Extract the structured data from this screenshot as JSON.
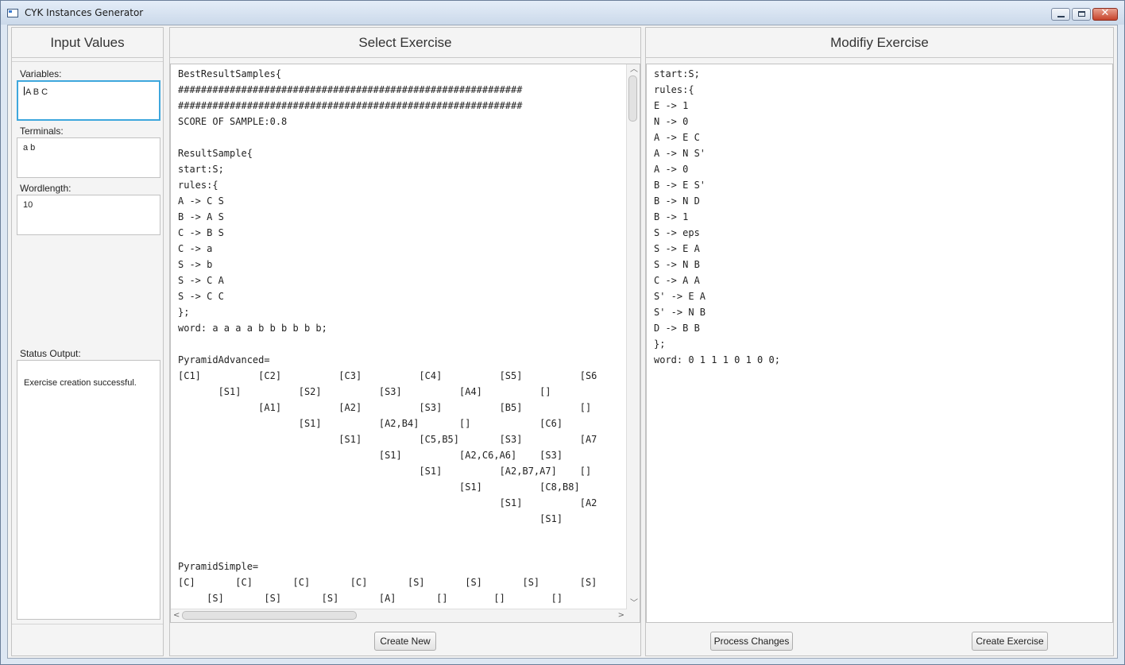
{
  "window": {
    "title": "CYK Instances Generator"
  },
  "input_panel": {
    "title": "Input Values",
    "variables_label": "Variables:",
    "variables_value": "A B C",
    "terminals_label": "Terminals:",
    "terminals_value": "a b",
    "wordlength_label": "Wordlength:",
    "wordlength_value": "10",
    "status_label": "Status Output:",
    "status_value": "Exercise creation successful."
  },
  "select_panel": {
    "title": "Select Exercise",
    "content": "BestResultSamples{\n############################################################\n############################################################\nSCORE OF SAMPLE:0.8\n\nResultSample{\nstart:S;\nrules:{\nA -> C S\nB -> A S\nC -> B S\nC -> a\nS -> b\nS -> C A\nS -> C C\n};\nword: a a a a b b b b b b;\n\nPyramidAdvanced=\n[C1]          [C2]          [C3]          [C4]          [S5]          [S6\n       [S1]          [S2]          [S3]          [A4]          []\n              [A1]          [A2]          [S3]          [B5]          []\n                     [S1]          [A2,B4]       []            [C6]\n                            [S1]          [C5,B5]       [S3]          [A7\n                                   [S1]          [A2,C6,A6]    [S3]\n                                          [S1]          [A2,B7,A7]    []\n                                                 [S1]          [C8,B8]\n                                                        [S1]          [A2\n                                                               [S1]\n\n\nPyramidSimple=\n[C]       [C]       [C]       [C]       [S]       [S]       [S]       [S]\n     [S]       [S]       [S]       [A]       []        []        []\n          [A]       [A]       [S]       [B]       []        []        []",
    "create_new_label": "Create New"
  },
  "modify_panel": {
    "title": "Modifiy Exercise",
    "content": "start:S;\nrules:{\nE -> 1\nN -> 0\nA -> E C\nA -> N S'\nA -> 0\nB -> E S'\nB -> N D\nB -> 1\nS -> eps\nS -> E A\nS -> N B\nC -> A A\nS' -> E A\nS' -> N B\nD -> B B\n};\nword: 0 1 1 1 0 1 0 0;",
    "process_changes_label": "Process Changes",
    "create_exercise_label": "Create Exercise"
  },
  "icons": {
    "window_icon": "app-window-icon",
    "minimize": "minimize-icon",
    "maximize": "maximize-icon",
    "close": "close-icon"
  },
  "colors": {
    "focus_border": "#3ea7dd",
    "close_button": "#c6432b"
  }
}
